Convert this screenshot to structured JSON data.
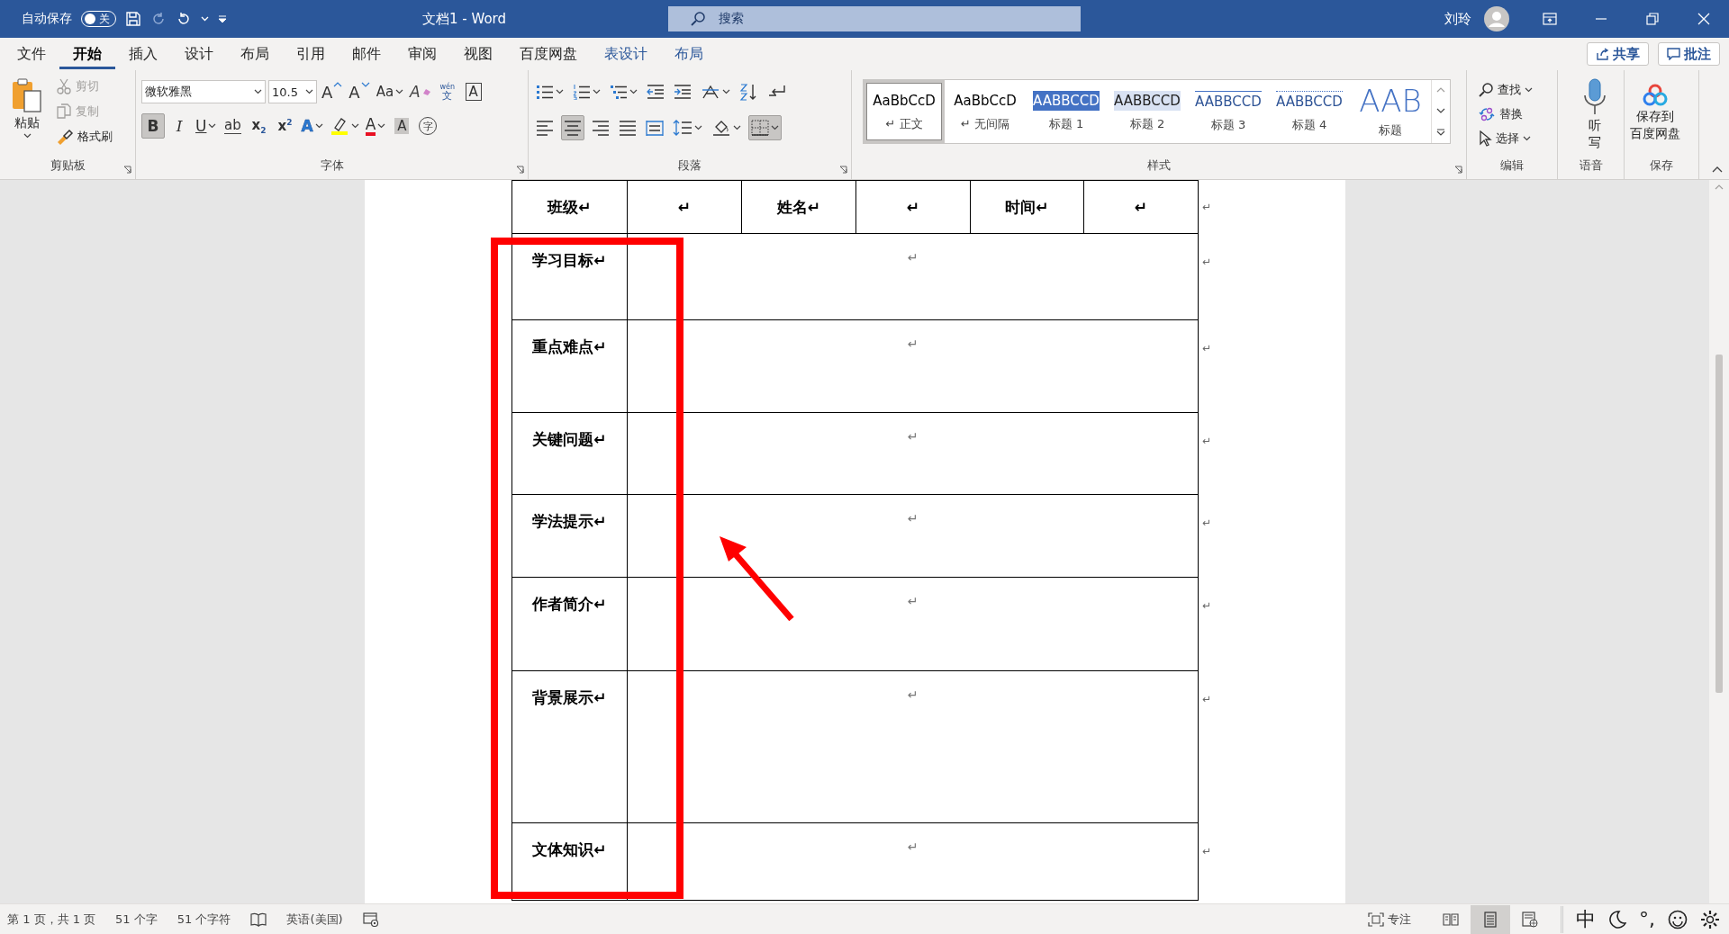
{
  "title_bar": {
    "autosave_label": "自动保存",
    "autosave": {
      "on": false,
      "label": "关"
    },
    "document_title": "文档1  -  Word",
    "search": {
      "placeholder": "搜索"
    },
    "user": "刘玲"
  },
  "tabs": [
    {
      "label": "文件",
      "selected": false,
      "kind": "normal"
    },
    {
      "label": "开始",
      "selected": true,
      "kind": "normal"
    },
    {
      "label": "插入",
      "selected": false,
      "kind": "normal"
    },
    {
      "label": "设计",
      "selected": false,
      "kind": "normal"
    },
    {
      "label": "布局",
      "selected": false,
      "kind": "normal"
    },
    {
      "label": "引用",
      "selected": false,
      "kind": "normal"
    },
    {
      "label": "邮件",
      "selected": false,
      "kind": "normal"
    },
    {
      "label": "审阅",
      "selected": false,
      "kind": "normal"
    },
    {
      "label": "视图",
      "selected": false,
      "kind": "normal"
    },
    {
      "label": "百度网盘",
      "selected": false,
      "kind": "normal"
    },
    {
      "label": "表设计",
      "selected": false,
      "kind": "contextual"
    },
    {
      "label": "布局",
      "selected": false,
      "kind": "contextual"
    }
  ],
  "share": "共享",
  "comments": "批注",
  "ribbon": {
    "clipboard": {
      "label": "剪贴板",
      "paste": "粘贴",
      "tools": [
        {
          "kind": "cut",
          "label": "剪切",
          "disabled": true
        },
        {
          "kind": "copy",
          "label": "复制",
          "disabled": true
        },
        {
          "kind": "painter",
          "label": "格式刷",
          "disabled": false
        }
      ]
    },
    "font": {
      "label": "字体",
      "font_name": "微软雅黑",
      "font_size": "10.5",
      "row1": [
        {
          "kind": "grow",
          "glyph": "A"
        },
        {
          "kind": "shrink",
          "glyph": "A"
        },
        {
          "kind": "case",
          "glyph": "Aa",
          "menu": true
        },
        {
          "kind": "clear",
          "glyph": "A"
        },
        {
          "kind": "phonetic",
          "glyph": "文",
          "ruby": "wén"
        },
        {
          "kind": "border",
          "glyph": "A"
        }
      ],
      "row2": [
        {
          "kind": "bold",
          "glyph": "B",
          "selected": true
        },
        {
          "kind": "italic",
          "glyph": "I",
          "selected": false
        },
        {
          "kind": "underline",
          "glyph": "U",
          "selected": false,
          "menu": true
        },
        {
          "kind": "strike",
          "glyph": "ab",
          "selected": false
        },
        {
          "kind": "sub",
          "glyph": "x",
          "index": "2",
          "selected": false
        },
        {
          "kind": "sup",
          "glyph": "x",
          "index": "2",
          "selected": false
        },
        {
          "kind": "effect",
          "glyph": "A",
          "selected": false,
          "menu": true
        },
        {
          "kind": "highlight",
          "selected": false,
          "menu": true
        },
        {
          "kind": "color",
          "glyph": "A",
          "selected": false,
          "menu": true
        },
        {
          "kind": "shading",
          "glyph": "A",
          "selected": false
        },
        {
          "kind": "enclose",
          "glyph": "字",
          "selected": false
        }
      ]
    },
    "paragraph": {
      "label": "段落",
      "row1": [
        {
          "kind": "bullets",
          "menu": true
        },
        {
          "kind": "numbering",
          "menu": true
        },
        {
          "kind": "multilevel",
          "menu": true
        },
        {
          "kind": "outdent"
        },
        {
          "kind": "indent"
        },
        {
          "kind": "asian",
          "menu": true
        },
        {
          "kind": "sort"
        },
        {
          "kind": "marks"
        }
      ],
      "row2": [
        {
          "kind": "align-left",
          "selected": false
        },
        {
          "kind": "align-center",
          "selected": true
        },
        {
          "kind": "align-right",
          "selected": false
        },
        {
          "kind": "justify",
          "selected": false
        },
        {
          "kind": "distribute",
          "selected": false
        },
        {
          "kind": "line-spacing",
          "selected": false,
          "menu": true
        },
        {
          "kind": "shading",
          "selected": false,
          "menu": true
        },
        {
          "kind": "borders",
          "selected": true,
          "menu": true
        }
      ]
    },
    "styles": {
      "label": "样式",
      "items": [
        {
          "preview": "AaBbCcD",
          "name": "↵ 正文",
          "kind": "body",
          "selected": true
        },
        {
          "preview": "AaBbCcD",
          "name": "↵ 无间隔",
          "kind": "body",
          "selected": false
        },
        {
          "preview": "AABBCCD",
          "name": "标题 1",
          "kind": "heading1",
          "selected": false
        },
        {
          "preview": "AABBCCD",
          "name": "标题 2",
          "kind": "heading2",
          "selected": false
        },
        {
          "preview": "AABBCCD",
          "name": "标题 3",
          "kind": "heading3",
          "selected": false
        },
        {
          "preview": "AABBCCD",
          "name": "标题 4",
          "kind": "heading4",
          "selected": false
        },
        {
          "preview": "AAB",
          "name": "标题",
          "kind": "title",
          "selected": false
        }
      ]
    },
    "editing": {
      "label": "编辑",
      "tools": [
        {
          "kind": "find",
          "label": "查找",
          "menu": true
        },
        {
          "kind": "replace",
          "label": "替换"
        },
        {
          "kind": "select",
          "label": "选择",
          "menu": true
        }
      ]
    },
    "voice": {
      "label": "语音",
      "button": [
        "听",
        "写"
      ]
    },
    "save": {
      "label": "保存",
      "button": [
        "保存到",
        "百度网盘"
      ]
    }
  },
  "document": {
    "header": [
      "班级↵",
      "↵",
      "姓名↵",
      "↵",
      "时间↵",
      "↵"
    ],
    "header_end": "↵",
    "rows": [
      {
        "label": "学习目标↵",
        "content": "↵",
        "end": "↵"
      },
      {
        "label": "重点难点↵",
        "content": "↵",
        "end": "↵"
      },
      {
        "label": "关键问题↵",
        "content": "↵",
        "end": "↵"
      },
      {
        "label": "学法提示↵",
        "content": "↵",
        "end": "↵"
      },
      {
        "label": "作者简介↵",
        "content": "↵",
        "end": "↵"
      },
      {
        "label": "背景展示↵",
        "content": "↵",
        "end": "↵"
      },
      {
        "label": "文体知识↵",
        "content": "↵",
        "end": "↵"
      }
    ],
    "annotations": {
      "frame": true,
      "arrow": true
    }
  },
  "status_bar": {
    "left": [
      {
        "kind": "text",
        "label": "第 1 页，共 1 页"
      },
      {
        "kind": "text",
        "label": "51 个字"
      },
      {
        "kind": "text",
        "label": "51 个字符"
      },
      {
        "kind": "proofing"
      },
      {
        "kind": "text",
        "label": "英语(美国)"
      },
      {
        "kind": "macro"
      }
    ],
    "focus": "专注",
    "views": [
      {
        "kind": "read",
        "selected": false
      },
      {
        "kind": "print",
        "selected": true
      },
      {
        "kind": "web",
        "selected": false
      }
    ],
    "tray": [
      {
        "kind": "text",
        "label": "中"
      },
      {
        "kind": "moon"
      },
      {
        "kind": "text",
        "label": "°,"
      },
      {
        "kind": "smile"
      },
      {
        "kind": "gear"
      }
    ]
  }
}
